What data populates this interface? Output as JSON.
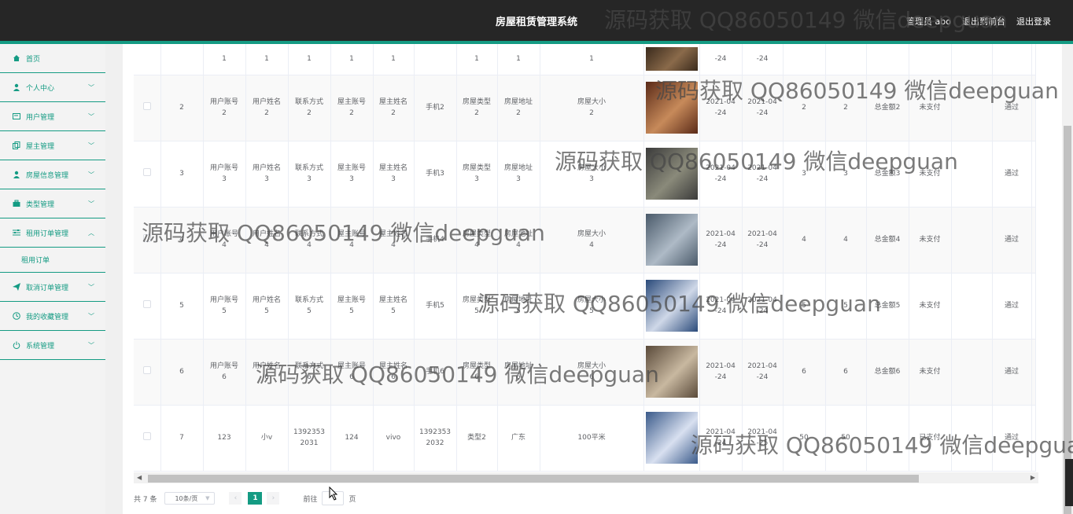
{
  "header": {
    "title": "房屋租赁管理系统",
    "user": "管理员 abo",
    "back_label": "退出到前台",
    "logout_label": "退出登录"
  },
  "sidebar": {
    "items": [
      {
        "label": "首页",
        "icon": "home-icon"
      },
      {
        "label": "个人中心",
        "icon": "user-icon"
      },
      {
        "label": "用户管理",
        "icon": "card-icon"
      },
      {
        "label": "屋主管理",
        "icon": "copy-icon"
      },
      {
        "label": "房屋信息管理",
        "icon": "user-icon"
      },
      {
        "label": "类型管理",
        "icon": "suitcase-icon"
      },
      {
        "label": "租用订单管理",
        "icon": "sliders-icon"
      },
      {
        "label": "取消订单管理",
        "icon": "send-icon"
      },
      {
        "label": "我的收藏管理",
        "icon": "clock-icon"
      },
      {
        "label": "系统管理",
        "icon": "power-icon"
      }
    ],
    "open_submenu": "租用订单"
  },
  "table": {
    "rows": [
      {
        "cells": [
          "1",
          "1",
          "1",
          "1",
          "1",
          "",
          "1",
          "1",
          "1"
        ],
        "d1": "-24",
        "d2": "-24",
        "n1": "",
        "n2": "",
        "total": "",
        "status": "",
        "review": ""
      },
      {
        "cells": [
          "2",
          "用户账号\n2",
          "用户姓名\n2",
          "联系方式\n2",
          "屋主账号\n2",
          "屋主姓名\n2",
          "手机2",
          "房屋类型\n2",
          "房屋地址\n2",
          "房屋大小\n2"
        ],
        "d1": "2021-04\n-24",
        "d2": "2021-04\n-24",
        "n1": "2",
        "n2": "2",
        "total": "总金额2",
        "status": "未支付",
        "review": "通过"
      },
      {
        "cells": [
          "3",
          "用户账号\n3",
          "用户姓名\n3",
          "联系方式\n3",
          "屋主账号\n3",
          "屋主姓名\n3",
          "手机3",
          "房屋类型\n3",
          "房屋地址\n3",
          "房屋大小\n3"
        ],
        "d1": "2021-04\n-24",
        "d2": "2021-04\n-24",
        "n1": "3",
        "n2": "3",
        "total": "总金额3",
        "status": "未支付",
        "review": "通过"
      },
      {
        "cells": [
          "4",
          "用户账号\n4",
          "用户姓名\n4",
          "联系方式\n4",
          "屋主账号\n4",
          "屋主姓名\n4",
          "手机4",
          "房屋类型\n4",
          "房屋地址\n4",
          "房屋大小\n4"
        ],
        "d1": "2021-04\n-24",
        "d2": "2021-04\n-24",
        "n1": "4",
        "n2": "4",
        "total": "总金额4",
        "status": "未支付",
        "review": "通过"
      },
      {
        "cells": [
          "5",
          "用户账号\n5",
          "用户姓名\n5",
          "联系方式\n5",
          "屋主账号\n5",
          "屋主姓名\n5",
          "手机5",
          "房屋类型\n5",
          "房屋地址\n5",
          "房屋大小\n5"
        ],
        "d1": "2021-04\n-24",
        "d2": "2021-04\n-24",
        "n1": "5",
        "n2": "5",
        "total": "总金额5",
        "status": "未支付",
        "review": "通过"
      },
      {
        "cells": [
          "6",
          "用户账号\n6",
          "用户姓名\n6",
          "联系方式\n6",
          "屋主账号\n6",
          "屋主姓名\n6",
          "手机6",
          "房屋类型\n6",
          "房屋地址\n6",
          "房屋大小\n6"
        ],
        "d1": "2021-04\n-24",
        "d2": "2021-04\n-24",
        "n1": "6",
        "n2": "6",
        "total": "总金额6",
        "status": "未支付",
        "review": "通过"
      },
      {
        "cells": [
          "7",
          "123",
          "小v",
          "1392353\n2031",
          "124",
          "vivo",
          "1392353\n2032",
          "类型2",
          "广东",
          "100平米"
        ],
        "d1": "2021-04\n-24",
        "d2": "2021-04\n-25",
        "n1": "50",
        "n2": "50",
        "total": "",
        "status": "已支付",
        "review": "通过"
      }
    ]
  },
  "pagination": {
    "total": "共 7 条",
    "page_size": "10条/页",
    "current": "1",
    "goto_prefix": "前往",
    "goto_suffix": "页"
  },
  "watermark": "源码获取 QQ86050149 微信deepguan",
  "colors": {
    "accent": "#149b83",
    "header_bg": "#262626"
  }
}
